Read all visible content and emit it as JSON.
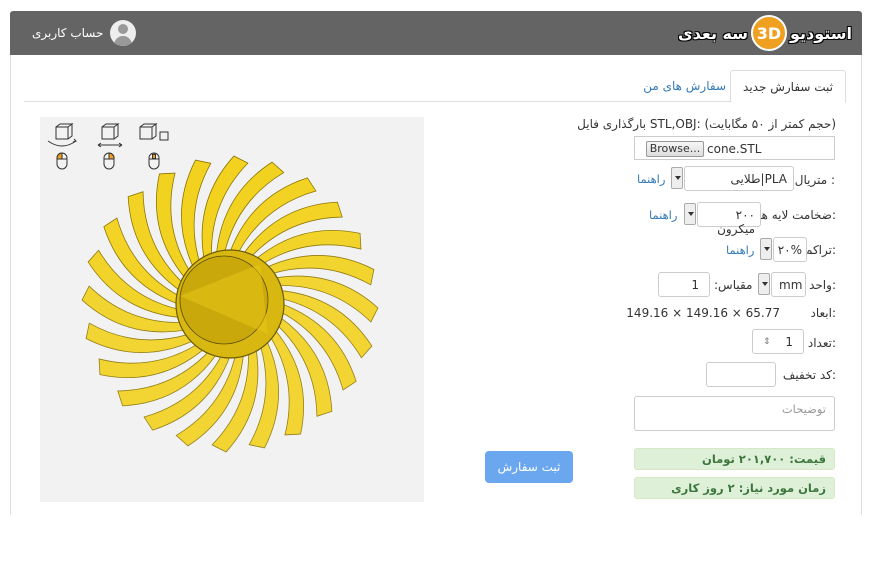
{
  "header": {
    "brand_part1": "استودیو",
    "brand_3d": "3D",
    "brand_part2": "سه بعدی",
    "account_label": "حساب کاربری"
  },
  "tabs": [
    {
      "label": "ثبت سفارش جدید",
      "active": true
    },
    {
      "label": "سفارش های من",
      "active": false
    }
  ],
  "form": {
    "upload_label": "بارگذاری فایل STL,OBJ: (حجم کمتر از ۵۰ مگابایت)",
    "browse_label": "Browse...",
    "file_name": "cone.STL",
    "material_label": "متریال :",
    "material_value": "PLA|طلایی",
    "layer_label": "ضخامت لایه ها:",
    "layer_value": "۲۰۰ میکرون",
    "density_label": "تراکم:",
    "density_value": "۲۰%",
    "unit_label": "واحد:",
    "unit_value": "mm",
    "scale_label": "مقیاس:",
    "scale_value": "1",
    "dimensions_label": "ابعاد:",
    "dimensions_value": "149.16 × 149.16 × 65.77",
    "quantity_label": "تعداد:",
    "quantity_value": "1",
    "discount_label": "کد تخفیف:",
    "discount_value": "",
    "notes_placeholder": "توضیحات",
    "help_label": "راهنما"
  },
  "price_text": "قیمت: ۲۰۱,۷۰۰ تومان",
  "time_text": "زمان مورد نیاز: ۲ روز کاری",
  "submit_label": "ثبت سفارش",
  "colors": {
    "header_bg": "#646464",
    "accent_orange": "#f0a020",
    "link_blue": "#337ab7",
    "model_yellow": "#f2d21e",
    "submit_bg": "#6aa7ee",
    "success_bg": "#dff0d8"
  }
}
